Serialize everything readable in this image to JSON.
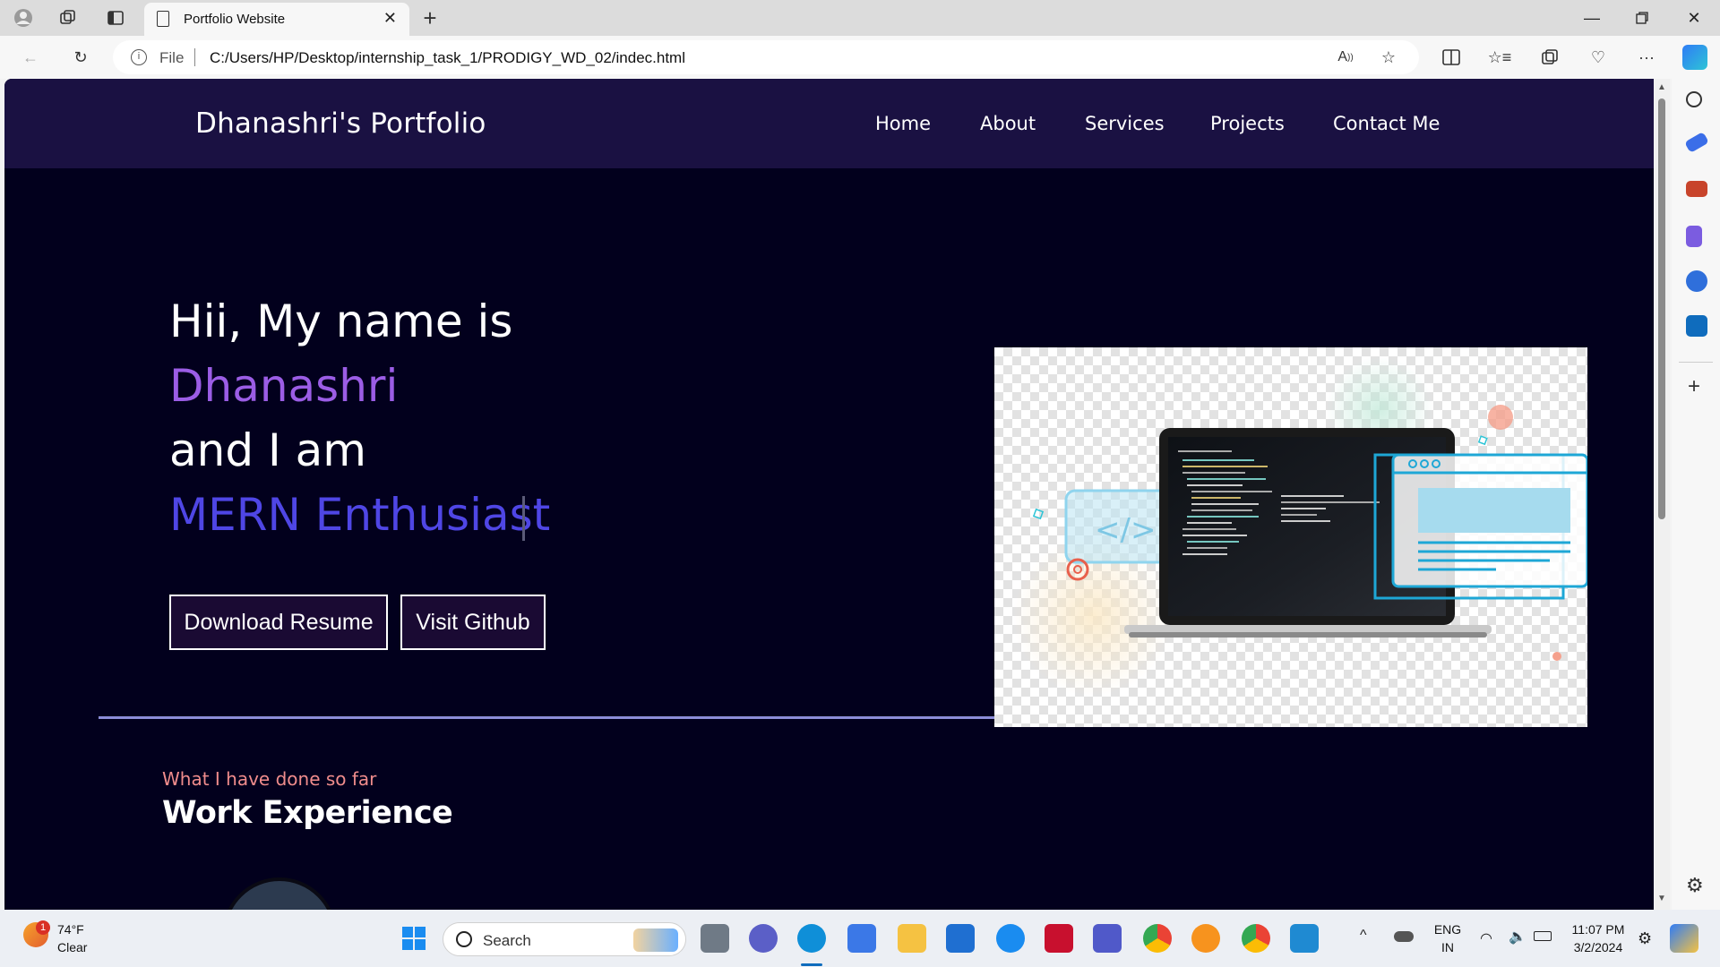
{
  "browser": {
    "tab_title": "Portfolio Website",
    "omnibox_file": "File",
    "url": "C:/Users/HP/Desktop/internship_task_1/PRODIGY_WD_02/indec.html"
  },
  "page": {
    "brand": "Dhanashri's Portfolio",
    "nav": [
      "Home",
      "About",
      "Services",
      "Projects",
      "Contact Me"
    ],
    "hero": {
      "line1": "Hii, My name is",
      "name": "Dhanashri",
      "line3": "and I am",
      "role": "MERN Enthusiast"
    },
    "buttons": {
      "resume": "Download Resume",
      "github": "Visit Github"
    },
    "section_subtitle": "What I have done so far",
    "section_title": "Work Experience"
  },
  "taskbar": {
    "weather_temp": "74°F",
    "weather_desc": "Clear",
    "weather_badge": "1",
    "search_label": "Search",
    "lang_line1": "ENG",
    "lang_line2": "IN",
    "time": "11:07 PM",
    "date": "3/2/2024"
  },
  "colors": {
    "page_bg": "#02001d",
    "navbar_bg": "#1a1142",
    "name_accent": "#9b5de5",
    "role_accent": "#4f46e5",
    "subtitle": "#f08c8c"
  }
}
